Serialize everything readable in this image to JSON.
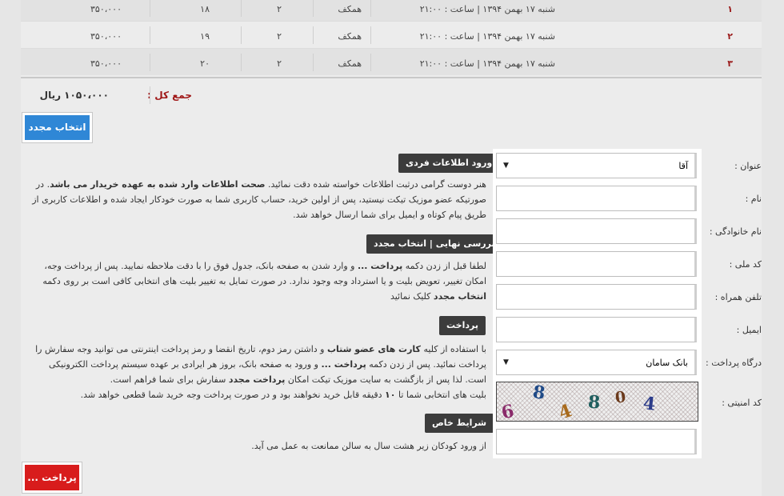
{
  "orders": {
    "rows": [
      {
        "index": "۱",
        "date": "شنبه ۱۷ بهمن ۱۳۹۴ | ساعت : ۲۱:۰۰",
        "hall": "همکف",
        "row": "۲",
        "seat": "۱۸",
        "price": "۳۵۰،۰۰۰"
      },
      {
        "index": "۲",
        "date": "شنبه ۱۷ بهمن ۱۳۹۴ | ساعت : ۲۱:۰۰",
        "hall": "همکف",
        "row": "۲",
        "seat": "۱۹",
        "price": "۳۵۰،۰۰۰"
      },
      {
        "index": "۳",
        "date": "شنبه ۱۷ بهمن ۱۳۹۴ | ساعت : ۲۱:۰۰",
        "hall": "همکف",
        "row": "۲",
        "seat": "۲۰",
        "price": "۳۵۰،۰۰۰"
      }
    ],
    "total_label": "جمع کل :",
    "total_value": "۱۰۵۰،۰۰۰ ریال"
  },
  "buttons": {
    "reselect": "انتخاب مجدد",
    "pay": "پرداخت ..."
  },
  "info": {
    "personal_header": "ورود اطلاعات فردی",
    "personal_p1": "هنر دوست گرامی درثبت اطلاعات خواسته شده دقت نمائید. ",
    "personal_p1_b": "صحت اطلاعات وارد شده به عهده خریدار می باشد",
    "personal_p2": ". در صورتیکه عضو موزیک تیکت نیستید، پس از اولین خرید، حساب کاربری شما به صورت خودکار ایجاد شده و اطلاعات کاربری از طریق پیام کوتاه و ایمیل برای شما ارسال خواهد شد.",
    "review_header": "بررسی نهایی | انتخاب مجدد",
    "review_p1": "لطفا قبل از زدن دکمه ",
    "review_p1_b": "پرداخت ...",
    "review_p2": " و وارد شدن به صفحه بانک، جدول فوق را با دقت ملاحظه نمایید. پس از پرداخت وجه، امکان تغییر، تعویض بلیت و یا استرداد وجه وجود ندارد. در صورت تمایل به تغییر بلیت های انتخابی کافی است بر روی دکمه ",
    "review_p2_b": "انتخاب مجدد",
    "review_p3": " کلیک نمائید",
    "payment_header": "پرداخت",
    "payment_p1": "با استفاده از کلیه ",
    "payment_p1_b": "کارت های عضو شتاب",
    "payment_p2": " و داشتن رمز دوم، تاریخ انقضا و رمز پرداخت اینترنتی می توانید وجه سفارش را پرداخت نمائید. پس از زدن دکمه ",
    "payment_p2_b": "پرداخت ...",
    "payment_p3": " و ورود به صفحه بانک، بروز هر ایرادی بر عهده سیستم پرداخت الکترونیکی است. لذا پس از بازگشت به سایت موزیک تیکت امکان ",
    "payment_p3_b": "پرداخت مجدد",
    "payment_p4": " سفارش برای شما فراهم است.",
    "payment_p5": "بلیت های انتخابی شما تا ",
    "payment_p5_b": "۱۰",
    "payment_p6": " دقیقه قابل خرید نخواهند بود و در صورت پرداخت وجه خرید شما قطعی خواهد شد.",
    "special_header": "شرایط خاص",
    "special_p1": "از ورود کودکان زیر هشت سال به سالن ممانعت به عمل می آید."
  },
  "form": {
    "title_label": "عنوان :",
    "title_value": "آقا",
    "name_label": "نام :",
    "family_label": "نام خانوادگی :",
    "national_code_label": "کد ملی :",
    "mobile_label": "تلفن همراه :",
    "email_label": "ایمیل :",
    "gateway_label": "درگاه پرداخت :",
    "gateway_value": "بانک سامان",
    "captcha_label": "کد امنیتی :",
    "captcha_digits": [
      "6",
      "8",
      "4",
      "8",
      "0",
      "4"
    ]
  },
  "colors": {
    "reselect_button": "#2f87d6",
    "pay_button": "#d81c1c",
    "total_label": "#a01818",
    "header_bg": "#3c3c3c"
  }
}
